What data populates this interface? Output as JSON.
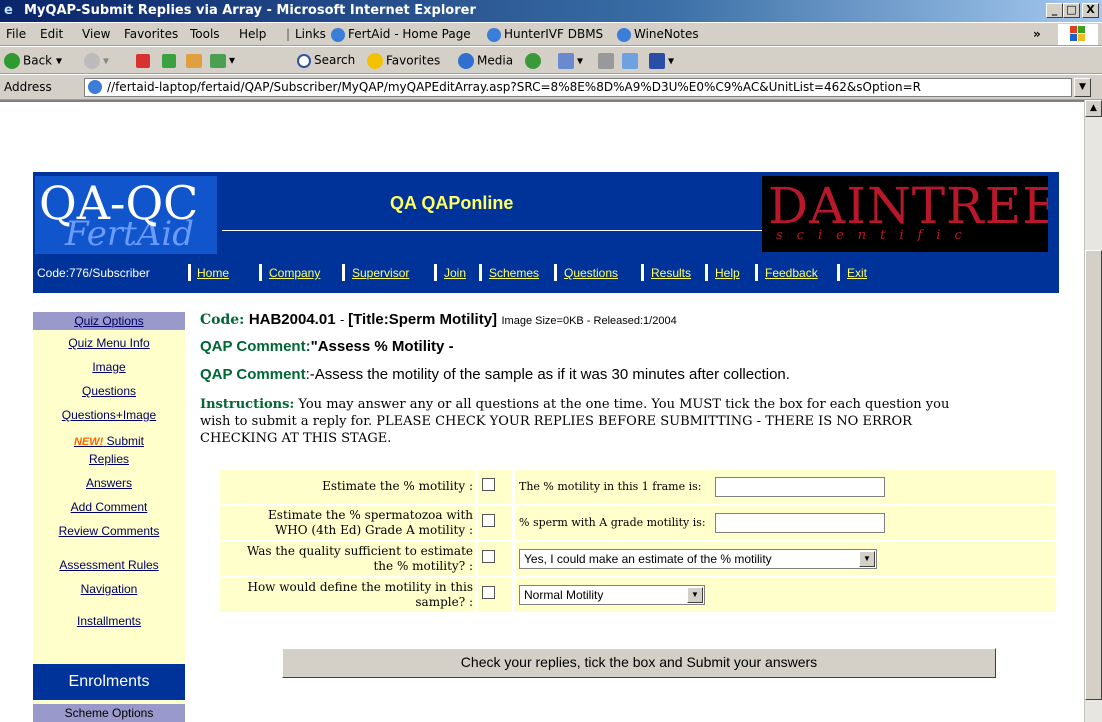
{
  "window": {
    "title": "MyQAP-Submit Replies via Array - Microsoft Internet Explorer",
    "controls": [
      "_",
      "□",
      "X"
    ]
  },
  "menu": [
    "File",
    "Edit",
    "View",
    "Favorites",
    "Tools",
    "Help"
  ],
  "links_bar": {
    "label": "Links",
    "items": [
      "FertAid - Home Page",
      "HunterIVF DBMS",
      "WineNotes"
    ],
    "more": "»"
  },
  "toolbar": {
    "back": "Back",
    "search": "Search",
    "favorites": "Favorites",
    "media": "Media"
  },
  "address": {
    "label": "Address",
    "url": "//fertaid-laptop/fertaid/QAP/Subscriber/MyQAP/myQAPEditArray.asp?SRC=8%8E%8D%A9%D3U%E0%C9%AC&UnitList=462&sOption=R"
  },
  "header": {
    "logo_line1": "QA-QC",
    "logo_line2": "FertAid",
    "title": "QA QAPonline",
    "brand_line1": "DAINTREE",
    "brand_line2": "scientific"
  },
  "nav": {
    "code": "Code:776/Subscriber",
    "links": [
      "Home",
      "Company",
      "Supervisor",
      "Join",
      "Schemes",
      "Questions",
      "Results",
      "Help",
      "Feedback",
      "Exit"
    ]
  },
  "sidebar": {
    "header": "Quiz Options",
    "items": [
      "Quiz Menu Info",
      "Image",
      "Questions",
      "Questions+Image",
      "Submit",
      "Replies",
      "Answers",
      "Add Comment",
      "Review Comments",
      "Assessment Rules",
      "Navigation",
      "Installments"
    ],
    "new_badge": "NEW!",
    "enrolments": "Enrolments",
    "scheme_options": "Scheme Options"
  },
  "main": {
    "code_label": "Code:",
    "code_value": "HAB2004.01",
    "title_label": "[Title:Sperm Motility]",
    "meta": "Image Size=0KB - Released:1/2004",
    "comment1_label": "QAP Comment:",
    "comment1_text": "\"Assess % Motility -",
    "comment2_label": "QAP Comment",
    "comment2_text": ":-Assess the motility of the sample as if it was 30 minutes after collection.",
    "instructions_label": "Instructions:",
    "instructions_line1": "You may answer any or all questions at the one time. You MUST tick the box for each question you",
    "instructions_line2": "wish to submit a reply for. PLEASE CHECK YOUR REPLIES BEFORE SUBMITTING - THERE IS NO ERROR",
    "instructions_line3": "CHECKING AT THIS STAGE."
  },
  "questions": [
    {
      "label": "Estimate the % motility :",
      "answer_label": "The % motility in this 1 frame is:",
      "input_value": ""
    },
    {
      "label_line1": "Estimate the % spermatozoa with",
      "label_line2": "WHO (4th Ed) Grade A motility :",
      "answer_label": "% sperm with A grade motility is:",
      "input_value": ""
    },
    {
      "label_line1": "Was the quality sufficient to estimate",
      "label_line2": "the % motility? :",
      "select_value": "Yes, I could make an estimate of the % motility"
    },
    {
      "label_line1": "How would define the motility in this",
      "label_line2": "sample? :",
      "select_value": "Normal Motility"
    }
  ],
  "submit_label": "Check your replies, tick the box and Submit your answers"
}
